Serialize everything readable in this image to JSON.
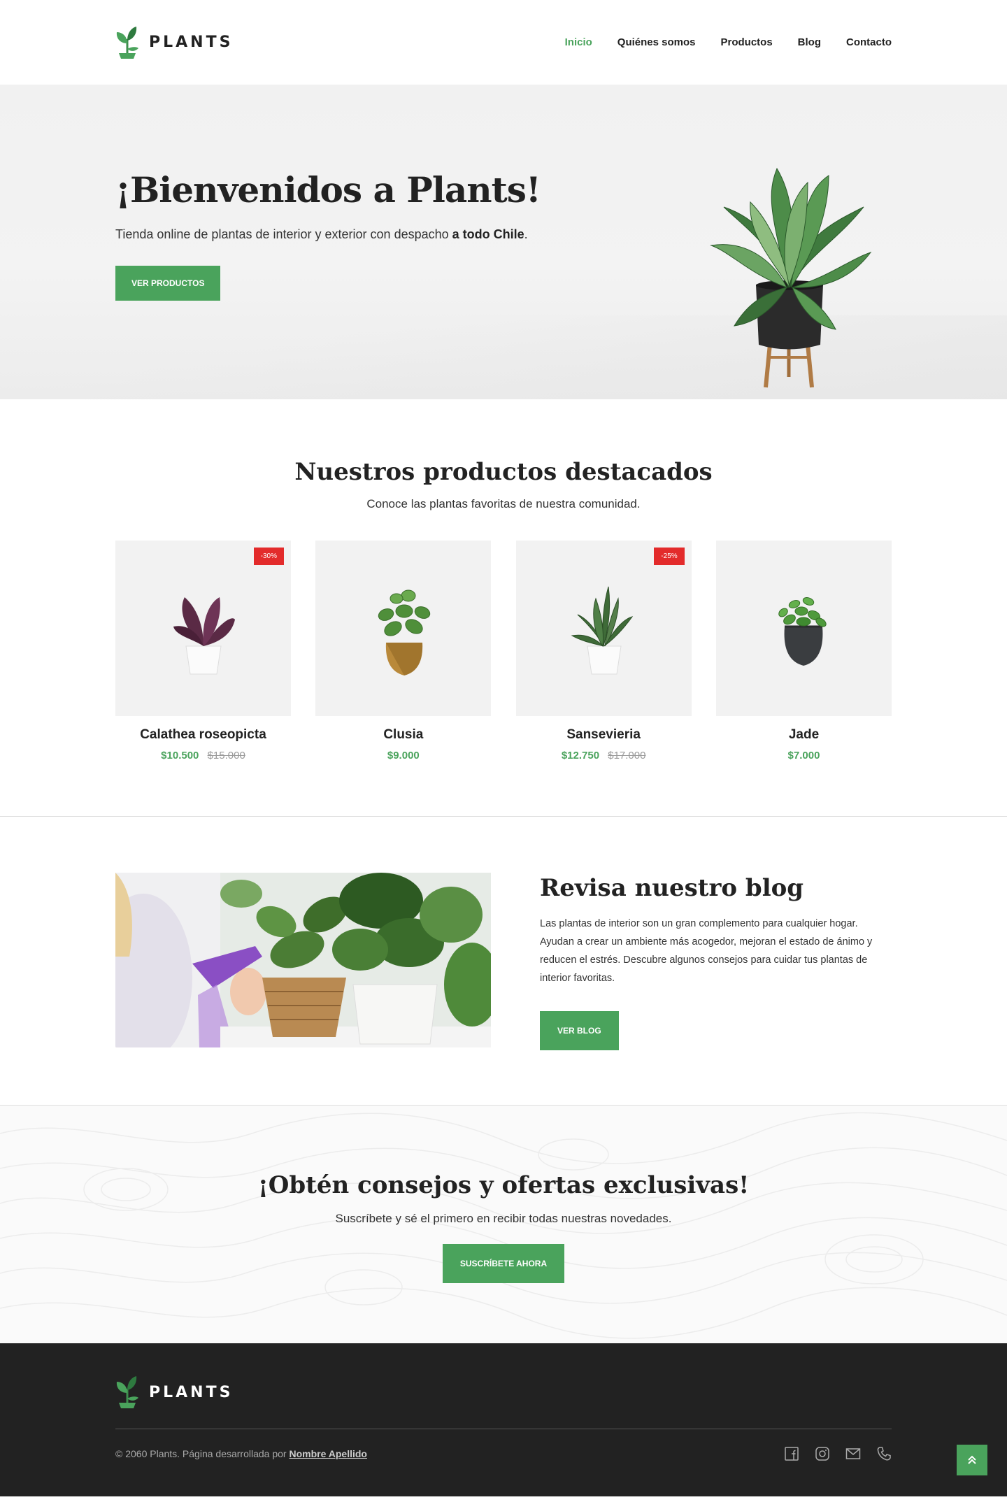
{
  "brand": {
    "name": "PLANTS",
    "logo_icon": "sprout-logo-icon",
    "accent": "#4aa35c"
  },
  "nav": {
    "items": [
      {
        "label": "Inicio",
        "active": true
      },
      {
        "label": "Quiénes somos",
        "active": false
      },
      {
        "label": "Productos",
        "active": false
      },
      {
        "label": "Blog",
        "active": false
      },
      {
        "label": "Contacto",
        "active": false
      }
    ]
  },
  "hero": {
    "title": "¡Bienvenidos a Plants!",
    "text_before": "Tienda online de plantas de interior y exterior con despacho ",
    "text_bold": "a todo Chile",
    "text_after": ".",
    "button": "VER PRODUCTOS"
  },
  "products": {
    "title": "Nuestros productos destacados",
    "subtitle": "Conoce las plantas favoritas de nuestra comunidad.",
    "items": [
      {
        "name": "Calathea roseopicta",
        "price": "$10.500",
        "old_price": "$15.000",
        "badge": "-30%"
      },
      {
        "name": "Clusia",
        "price": "$9.000",
        "old_price": "",
        "badge": ""
      },
      {
        "name": "Sansevieria",
        "price": "$12.750",
        "old_price": "$17.000",
        "badge": "-25%"
      },
      {
        "name": "Jade",
        "price": "$7.000",
        "old_price": "",
        "badge": ""
      }
    ]
  },
  "blog": {
    "title": "Revisa nuestro blog",
    "text": "Las plantas de interior son un gran complemento para cualquier hogar. Ayudan a crear un ambiente más acogedor, mejoran el estado de ánimo y reducen el estrés. Descubre algunos consejos para cuidar tus plantas de interior favoritas.",
    "button": "VER BLOG"
  },
  "newsletter": {
    "title": "¡Obtén consejos y ofertas exclusivas!",
    "subtitle": "Suscríbete y sé el primero en recibir todas nuestras novedades.",
    "button": "SUSCRÍBETE AHORA"
  },
  "footer": {
    "copyright_prefix": "© 2060 Plants. Página desarrollada por ",
    "author": "Nombre Apellido",
    "social_icons": [
      "facebook-icon",
      "instagram-icon",
      "mail-icon",
      "phone-icon"
    ],
    "to_top_icon": "double-chevron-up-icon"
  }
}
